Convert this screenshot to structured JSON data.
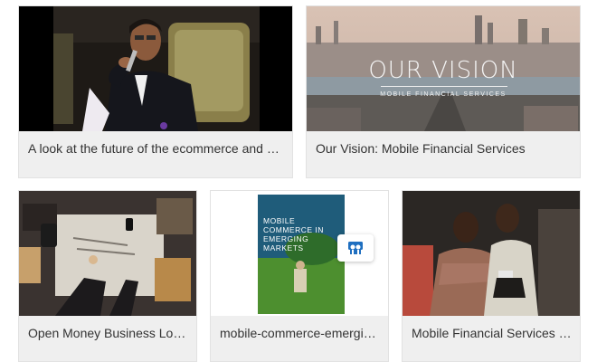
{
  "cards": [
    {
      "caption": "A look at the future of the ecommerce and payments landscape"
    },
    {
      "caption": "Our Vision: Mobile Financial Services",
      "overlay_title": "OUR VISION",
      "overlay_subtitle": "MOBILE FINANCIAL SERVICES"
    },
    {
      "caption": "Open Money Business Logic"
    },
    {
      "caption": "mobile-commerce-emerging-markets",
      "cover_text": "MOBILE COMMERCE IN EMERGING MARKETS"
    },
    {
      "caption": "Mobile Financial Services - Africa"
    }
  ],
  "colors": {
    "caption_bg": "#efefef",
    "caption_text": "#333333",
    "badge_icon": "#1f6fc0"
  },
  "icons": {
    "slideshare_badge": "slideshare-icon"
  }
}
